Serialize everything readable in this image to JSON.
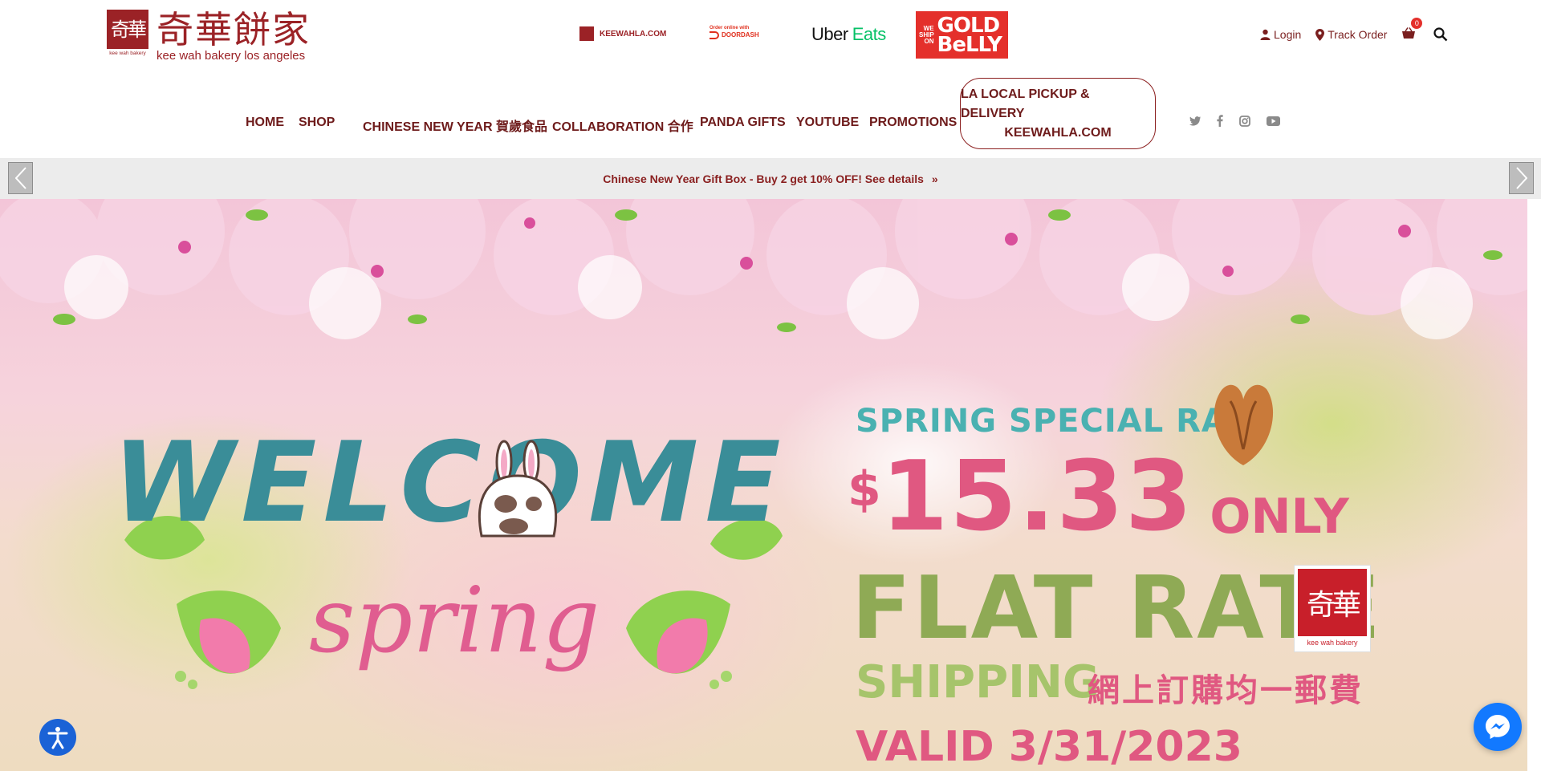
{
  "logo": {
    "mark_chars": "奇華",
    "mark_caption": "kee wah bakery",
    "name_cn": "奇華餅家",
    "name_en": "kee wah bakery los angeles"
  },
  "partners": {
    "keewahla": "KEEWAHLA.COM",
    "doordash_small": "Order online with",
    "doordash_big": "DOORDASH",
    "ubereats_uber": "Uber",
    "ubereats_eats": "Eats",
    "goldbelly_small": "WE SHIP ON",
    "goldbelly_big": "GOLD BeLLY"
  },
  "user": {
    "login": "Login",
    "track_order": "Track Order",
    "cart_count": "0"
  },
  "nav": {
    "items": [
      "HOME",
      "SHOP",
      "CHINESE NEW YEAR 賀歲食品",
      "COLLABORATION 合作",
      "PANDA GIFTS",
      "YOUTUBE",
      "PROMOTIONS"
    ],
    "cta_line1": "LA LOCAL PICKUP & DELIVERY",
    "cta_line2": "KEEWAHLA.COM"
  },
  "social": [
    "twitter-icon",
    "facebook-icon",
    "instagram-icon",
    "youtube-icon"
  ],
  "announcement": {
    "text": "Chinese New Year Gift Box - Buy 2 get 10% OFF! See details",
    "chevron": "»"
  },
  "hero": {
    "welcome": "WELCOME",
    "spring": "spring",
    "special": "SPRING SPECIAL RATE",
    "dollar": "$",
    "price": "15.33",
    "only": "ONLY",
    "flat": "FLAT RATE",
    "shipping": "SHIPPING",
    "cn": "網上訂購均一郵費",
    "valid": "VALID 3/31/2023",
    "logo_chars": "奇華",
    "logo_caption": "kee wah bakery"
  },
  "colors": {
    "brand": "#9b2226",
    "nav_text": "#6e1b1b",
    "announce_bg": "#ececec",
    "accessibility_blue": "#1a62d6",
    "messenger_blue": "#1279ff"
  }
}
